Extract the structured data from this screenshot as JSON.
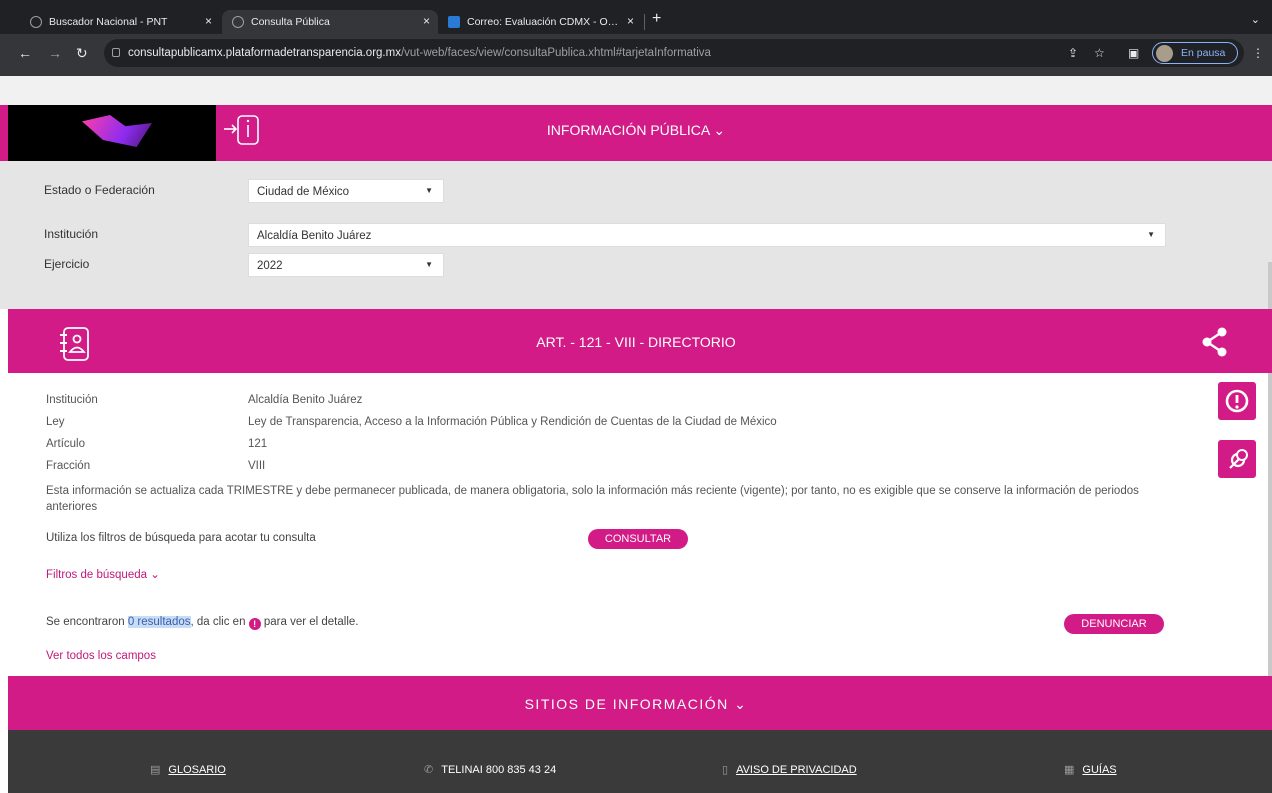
{
  "browser": {
    "tabs": [
      {
        "title": "Buscador Nacional - PNT",
        "close": "×"
      },
      {
        "title": "Consulta Pública",
        "close": "×"
      },
      {
        "title": "Correo: Evaluación CDMX - O…",
        "close": "×"
      }
    ],
    "new_tab": "+",
    "url_host": "consultapublicamx.plataformadetransparencia.org.mx",
    "url_path": "/vut-web/faces/view/consultaPublica.xhtml#tarjetaInformativa",
    "profile": "En pausa"
  },
  "header": {
    "menu_label": "INFORMACIÓN PÚBLICA ⌄"
  },
  "filters": {
    "state_label": "Estado o Federación",
    "state_value": "Ciudad de México",
    "institution_label": "Institución",
    "institution_value": "Alcaldía Benito Juárez",
    "year_label": "Ejercicio",
    "year_value": "2022"
  },
  "article": {
    "title": "ART. - 121 - VIII - DIRECTORIO"
  },
  "details": {
    "institution_label": "Institución",
    "institution_value": "Alcaldía Benito Juárez",
    "law_label": "Ley",
    "law_value": "Ley de Transparencia, Acceso a la Información Pública y Rendición de Cuentas de la Ciudad de México",
    "article_label": "Artículo",
    "article_value": "121",
    "fraction_label": "Fracción",
    "fraction_value": "VIII",
    "update_note": "Esta información se actualiza cada TRIMESTRE y debe permanecer publicada, de manera obligatoria, solo la información más reciente (vigente); por tanto, no es exigible que se conserve la información de periodos anteriores"
  },
  "search": {
    "hint": "Utiliza los filtros de búsqueda para acotar tu consulta",
    "consult_button": "CONSULTAR",
    "filters_toggle": "Filtros de búsqueda ⌄",
    "result_prefix": "Se encontraron ",
    "result_count": "0 resultados",
    "result_middle": ", da clic en ",
    "result_suffix": " para ver el detalle.",
    "report_button": "DENUNCIAR",
    "all_fields_link": "Ver todos los campos"
  },
  "sitios": {
    "label": "SITIOS DE INFORMACIÓN ⌄"
  },
  "footer": {
    "glossary": "GLOSARIO",
    "telinai": "TELINAI 800 835 43 24",
    "privacy": "AVISO DE PRIVACIDAD",
    "guides": "GUÍAS"
  },
  "colors": {
    "brand_pink": "#d21b86",
    "footer_dark": "#3a3a3a",
    "filter_bg": "#e5e5e5"
  }
}
